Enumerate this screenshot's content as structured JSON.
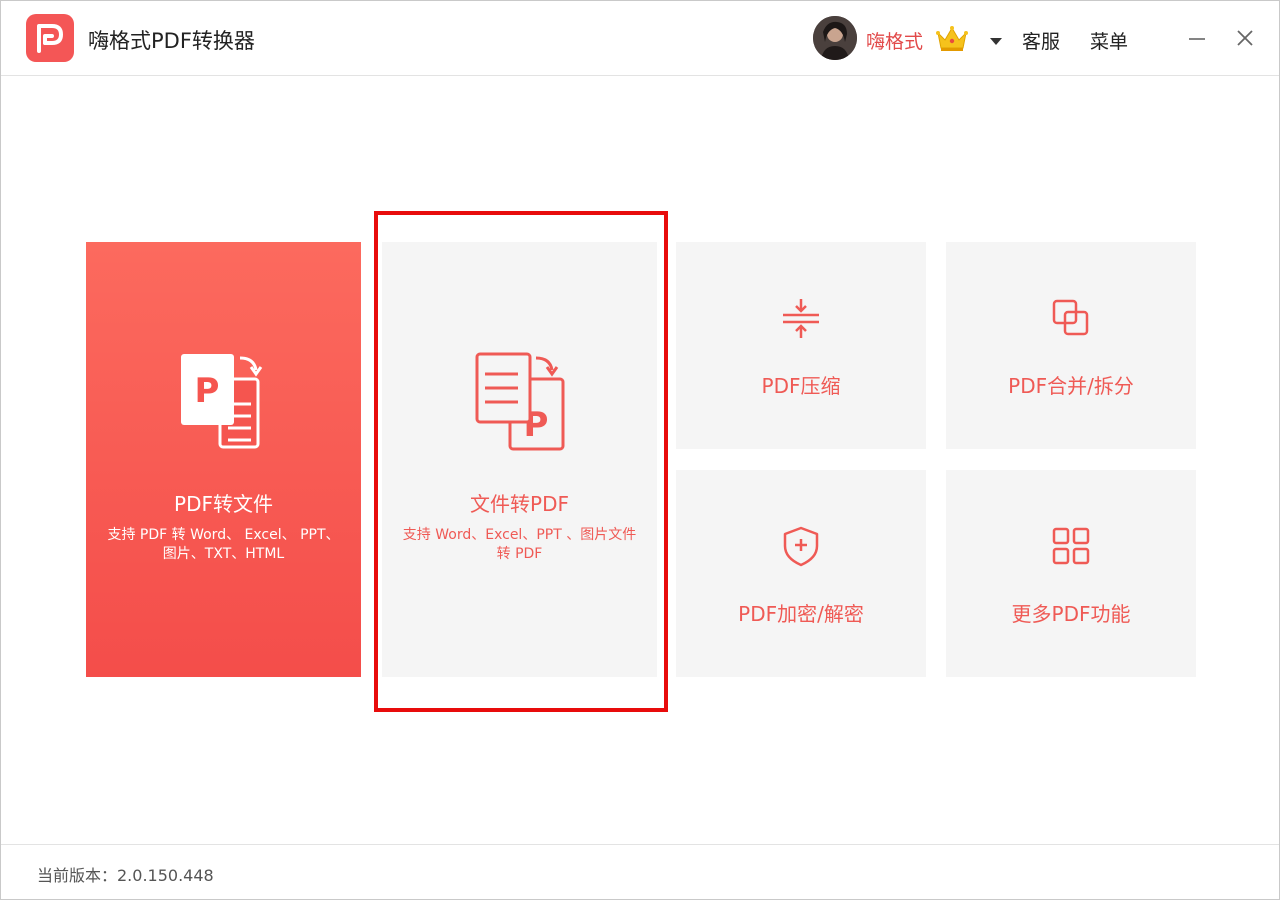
{
  "app": {
    "title": "嗨格式PDF转换器",
    "brand_color": "#f45656",
    "logo_icon": "p-logo-icon"
  },
  "header": {
    "username": "嗨格式",
    "vip_icon": "crown-icon",
    "service_label": "客服",
    "menu_label": "菜单"
  },
  "cards": {
    "pdf_to_file": {
      "title": "PDF转文件",
      "desc": "支持 PDF 转 Word、 Excel、 PPT、图片、TXT、HTML",
      "icon": "pdf-to-doc-icon"
    },
    "file_to_pdf": {
      "title": "文件转PDF",
      "desc": "支持 Word、Excel、PPT 、图片文件转 PDF",
      "icon": "doc-to-pdf-icon"
    },
    "compress": {
      "title": "PDF压缩",
      "icon": "compress-icon"
    },
    "merge_split": {
      "title": "PDF合并/拆分",
      "icon": "merge-icon"
    },
    "encrypt": {
      "title": "PDF加密/解密",
      "icon": "shield-plus-icon"
    },
    "more": {
      "title": "更多PDF功能",
      "icon": "grid-icon"
    }
  },
  "highlight_color": "#e80c0c",
  "footer": {
    "version": "当前版本：2.0.150.448"
  }
}
